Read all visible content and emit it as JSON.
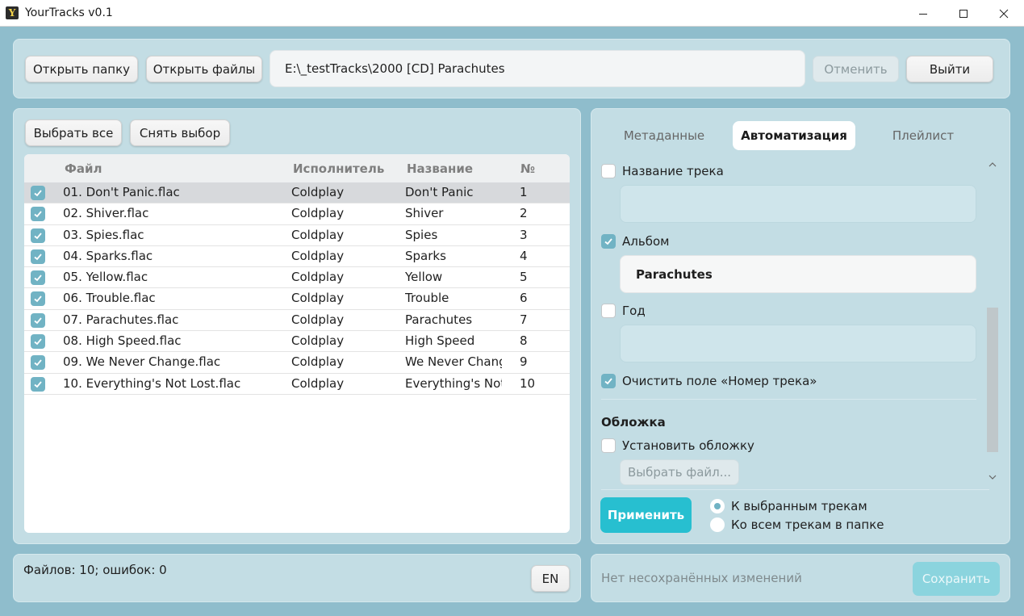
{
  "window": {
    "title": "YourTracks v0.1",
    "icon_letter": "Y"
  },
  "toolbar": {
    "open_folder": "Открыть папку",
    "open_files": "Открыть файлы",
    "path": "E:\\_testTracks\\2000 [CD]  Parachutes",
    "cancel": "Отменить",
    "exit": "Выйти"
  },
  "file_panel": {
    "select_all": "Выбрать все",
    "deselect": "Снять выбор",
    "columns": {
      "file": "Файл",
      "artist": "Исполнитель",
      "title": "Название",
      "number": "№"
    },
    "rows": [
      {
        "file": "01. Don't Panic.flac",
        "artist": "Coldplay",
        "title": "Don't Panic",
        "number": "1",
        "checked": true
      },
      {
        "file": "02. Shiver.flac",
        "artist": "Coldplay",
        "title": "Shiver",
        "number": "2",
        "checked": true
      },
      {
        "file": "03. Spies.flac",
        "artist": "Coldplay",
        "title": "Spies",
        "number": "3",
        "checked": true
      },
      {
        "file": "04. Sparks.flac",
        "artist": "Coldplay",
        "title": "Sparks",
        "number": "4",
        "checked": true
      },
      {
        "file": "05. Yellow.flac",
        "artist": "Coldplay",
        "title": "Yellow",
        "number": "5",
        "checked": true
      },
      {
        "file": "06. Trouble.flac",
        "artist": "Coldplay",
        "title": "Trouble",
        "number": "6",
        "checked": true
      },
      {
        "file": "07. Parachutes.flac",
        "artist": "Coldplay",
        "title": "Parachutes",
        "number": "7",
        "checked": true
      },
      {
        "file": "08. High Speed.flac",
        "artist": "Coldplay",
        "title": "High Speed",
        "number": "8",
        "checked": true
      },
      {
        "file": "09. We Never Change.flac",
        "artist": "Coldplay",
        "title": "We Never Chang",
        "number": "9",
        "checked": true
      },
      {
        "file": "10. Everything's Not Lost.flac",
        "artist": "Coldplay",
        "title": "Everything's Not",
        "number": "10",
        "checked": true
      }
    ]
  },
  "tabs": {
    "metadata": "Метаданные",
    "automation": "Автоматизация",
    "playlist": "Плейлист"
  },
  "automation": {
    "track_title": {
      "label": "Название трека",
      "checked": false,
      "value": ""
    },
    "album": {
      "label": "Альбом",
      "checked": true,
      "value": "Parachutes"
    },
    "year": {
      "label": "Год",
      "checked": false,
      "value": ""
    },
    "clear_track_number": {
      "label": "Очистить поле «Номер трека»",
      "checked": true
    },
    "cover_heading": "Обложка",
    "set_cover": {
      "label": "Установить обложку",
      "checked": false
    },
    "choose_file": "Выбрать файл...",
    "apply": "Применить",
    "scope_selected": "К выбранным трекам",
    "scope_all": "Ко всем трекам в папке",
    "scope_value": "selected"
  },
  "status": {
    "files": "Файлов: 10; ошибок: 0",
    "language": "EN",
    "unsaved": "Нет несохранённых изменений",
    "save": "Сохранить"
  },
  "colors": {
    "accent": "#27bfd0",
    "checkbox": "#71b3c4",
    "background": "#8fbdcc",
    "panel": "#c3dde4"
  }
}
